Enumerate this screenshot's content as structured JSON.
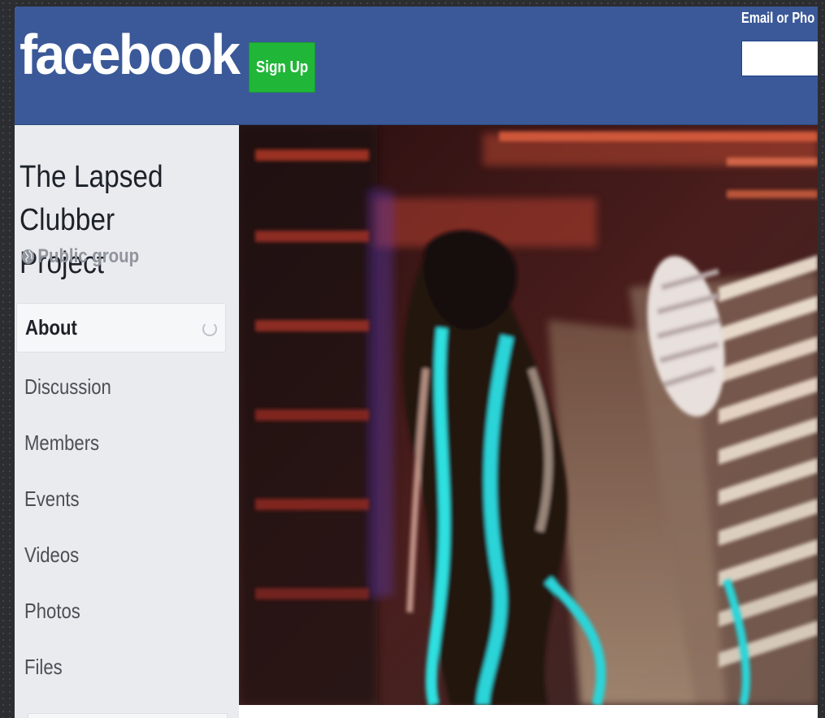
{
  "header": {
    "logo": "facebook",
    "signup_label": "Sign Up",
    "login_label": "Email or Pho",
    "login_value": ""
  },
  "group": {
    "title": "The Lapsed Clubber Project",
    "privacy": "Public group"
  },
  "nav": {
    "items": [
      {
        "label": "About",
        "active": true
      },
      {
        "label": "Discussion"
      },
      {
        "label": "Members"
      },
      {
        "label": "Events"
      },
      {
        "label": "Videos"
      },
      {
        "label": "Photos"
      },
      {
        "label": "Files"
      }
    ]
  },
  "colors": {
    "brand": "#3b5998",
    "signup": "#20b638"
  },
  "icons": {
    "privacy": "globe-icon",
    "loading": "spinner-icon"
  }
}
